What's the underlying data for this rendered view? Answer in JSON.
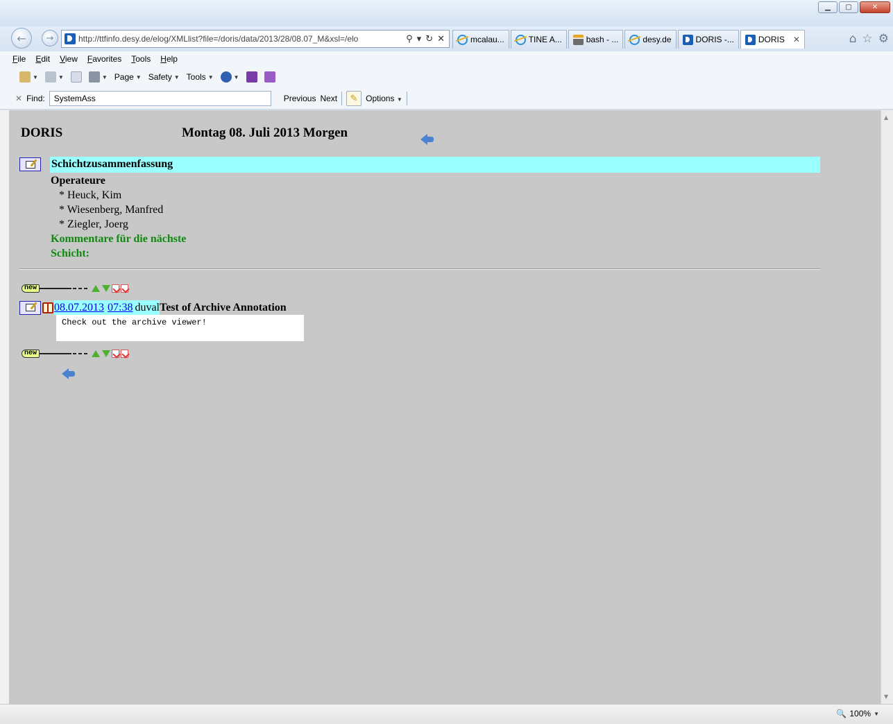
{
  "browser": {
    "address_url": "http://ttfinfo.desy.de/elog/XMLlist?file=/doris/data/2013/28/08.07_M&xsl=/elo",
    "tabs": [
      {
        "label": "mcalau...",
        "icon": "ie-icon"
      },
      {
        "label": "TINE A...",
        "icon": "ie-icon"
      },
      {
        "label": "bash - ...",
        "icon": "bash-icon"
      },
      {
        "label": "desy.de",
        "icon": "ie-icon"
      },
      {
        "label": "DORIS -...",
        "icon": "doris-icon"
      },
      {
        "label": "DORIS",
        "icon": "doris-icon",
        "active": true
      }
    ],
    "menu": [
      "File",
      "Edit",
      "View",
      "Favorites",
      "Tools",
      "Help"
    ],
    "commands": {
      "page": "Page",
      "safety": "Safety",
      "tools": "Tools"
    },
    "find": {
      "label": "Find:",
      "value": "SystemAss",
      "previous": "Previous",
      "next": "Next",
      "options": "Options"
    },
    "zoom": "100%"
  },
  "page": {
    "logo": "DORIS",
    "date_title": "Montag 08. Juli 2013 Morgen",
    "summary": {
      "title": "Schichtzusammenfassung",
      "operators_heading": "Operateure",
      "operators": [
        "* Heuck, Kim",
        "* Wiesenberg, Manfred",
        "* Ziegler, Joerg"
      ],
      "comment_line1": "Kommentare für die nächste",
      "comment_line2": "Schicht:"
    },
    "new_badge": "new",
    "entry": {
      "date": "08.07.2013",
      "time": "07:38",
      "author": "duval",
      "title": "Test of Archive Annotation",
      "body": "Check out the archive viewer!"
    }
  },
  "colors": {
    "summary_bar": "#99ffff",
    "content_bg": "#c8c8c8",
    "comment_green": "#118811",
    "link": "#0000ee"
  }
}
